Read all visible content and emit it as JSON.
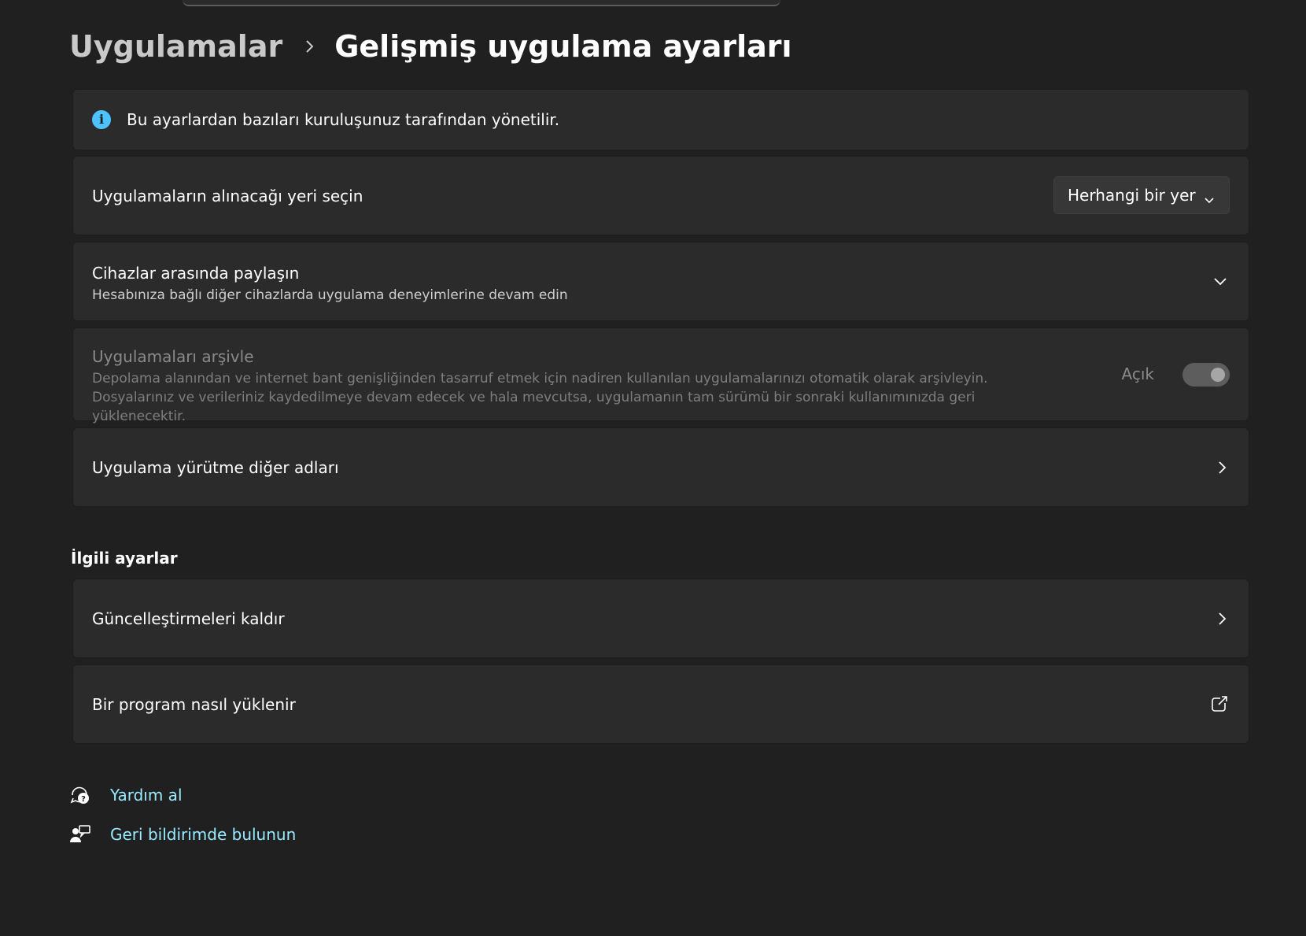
{
  "breadcrumb": {
    "parent": "Uygulamalar",
    "current": "Gelişmiş uygulama ayarları"
  },
  "info_banner": {
    "icon": "info-icon",
    "text": "Bu ayarlardan bazıları kuruluşunuz tarafından yönetilir."
  },
  "settings": {
    "app_source": {
      "label": "Uygulamaların alınacağı yeri seçin",
      "selected": "Herhangi bir yer"
    },
    "share_devices": {
      "title": "Cihazlar arasında paylaşın",
      "description": "Hesabınıza bağlı diğer cihazlarda uygulama deneyimlerine devam edin"
    },
    "archive_apps": {
      "title": "Uygulamaları arşivle",
      "description": "Depolama alanından ve internet bant genişliğinden tasarruf etmek için nadiren kullanılan uygulamalarınızı otomatik olarak arşivleyin. Dosyalarınız ve verileriniz kaydedilmeye devam edecek ve hala mevcutsa, uygulamanın tam sürümü bir sonraki kullanımınızda geri yüklenecektir.",
      "state": "Açık",
      "enabled": false
    },
    "execution_aliases": {
      "label": "Uygulama yürütme diğer adları"
    }
  },
  "related": {
    "heading": "İlgili ayarlar",
    "uninstall_updates": "Güncelleştirmeleri kaldır",
    "install_program": "Bir program nasıl yüklenir"
  },
  "footer": {
    "get_help": "Yardım al",
    "feedback": "Geri bildirimde bulunun"
  },
  "colors": {
    "background": "#202020",
    "card": "#2b2b2b",
    "accent_link": "#99ebff",
    "info": "#4cc2ff"
  }
}
